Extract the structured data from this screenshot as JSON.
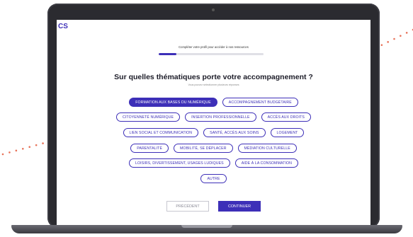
{
  "app": {
    "logo_text": "CS"
  },
  "progress": {
    "label": "Compléter votre profil pour accéder à nos ressources",
    "value": 0.17
  },
  "question": {
    "title": "Sur quelles thématiques porte votre accompagnement ?",
    "hint": "Vous pouvez sélectionner plusieurs réponses"
  },
  "options": {
    "rows": [
      [
        {
          "label": "FORMATION AUX BASES DU NUMÉRIQUE",
          "selected": true
        },
        {
          "label": "ACCOMPAGNEMENT BUDGÉTAIRE",
          "selected": false
        }
      ],
      [
        {
          "label": "CITOYENNETÉ NUMÉRIQUE",
          "selected": false
        },
        {
          "label": "INSERTION PROFESSIONNELLE",
          "selected": false
        },
        {
          "label": "ACCÈS AUX DROITS",
          "selected": false
        }
      ],
      [
        {
          "label": "LIEN SOCIAL ET COMMUNICATION",
          "selected": false
        },
        {
          "label": "SANTÉ, ACCÈS AUX SOINS",
          "selected": false
        },
        {
          "label": "LOGEMENT",
          "selected": false
        }
      ],
      [
        {
          "label": "PARENTALITÉ",
          "selected": false
        },
        {
          "label": "MOBILITÉ, SE DÉPLACER",
          "selected": false
        },
        {
          "label": "MÉDIATION CULTURELLE",
          "selected": false
        }
      ],
      [
        {
          "label": "LOISIRS, DIVERTISSEMENT, USAGES LUDIQUES",
          "selected": false
        },
        {
          "label": "AIDE À LA CONSOMMATION",
          "selected": false
        }
      ],
      [
        {
          "label": "AUTRE",
          "selected": false
        }
      ]
    ]
  },
  "buttons": {
    "previous_label": "PRÉCÉDENT",
    "continue_label": "CONTINUER"
  },
  "colors": {
    "accent": "#3d2fb8",
    "dots": "#e8735a"
  }
}
